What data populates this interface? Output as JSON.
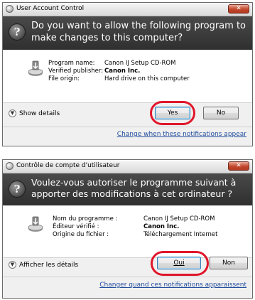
{
  "dialog_en": {
    "title": "User Account Control",
    "close_glyph": "✕",
    "question": "Do you want to allow the following program to make changes to this computer?",
    "info": [
      {
        "label": "Program name:",
        "value": "Canon IJ Setup CD-ROM"
      },
      {
        "label": "Verified publisher:",
        "value": "Canon Inc."
      },
      {
        "label": "File origin:",
        "value": "Hard drive on this computer"
      }
    ],
    "show_details": "Show details",
    "yes": "Yes",
    "no": "No",
    "change_link": "Change when these notifications appear"
  },
  "dialog_fr": {
    "title": "Contrôle de compte d'utilisateur",
    "close_glyph": "✕",
    "question": "Voulez-vous autoriser le programme suivant à apporter des modifications à cet ordinateur ?",
    "info": [
      {
        "label": "Nom du programme :",
        "value": "Canon IJ Setup CD-ROM"
      },
      {
        "label": "Éditeur vérifié :",
        "value": "Canon Inc."
      },
      {
        "label": "Origine du fichier :",
        "value": "Téléchargement Internet"
      }
    ],
    "show_details": "Afficher les détails",
    "yes": "Oui",
    "no": "Non",
    "change_link": "Changer quand ces notifications apparaissent"
  },
  "colors": {
    "highlight_ring": "#e0162b",
    "banner": "#3a3a3a",
    "link": "#1f4c9c"
  },
  "icons": [
    "shield-icon",
    "program-installer-icon",
    "chevron-down-icon",
    "close-icon"
  ]
}
